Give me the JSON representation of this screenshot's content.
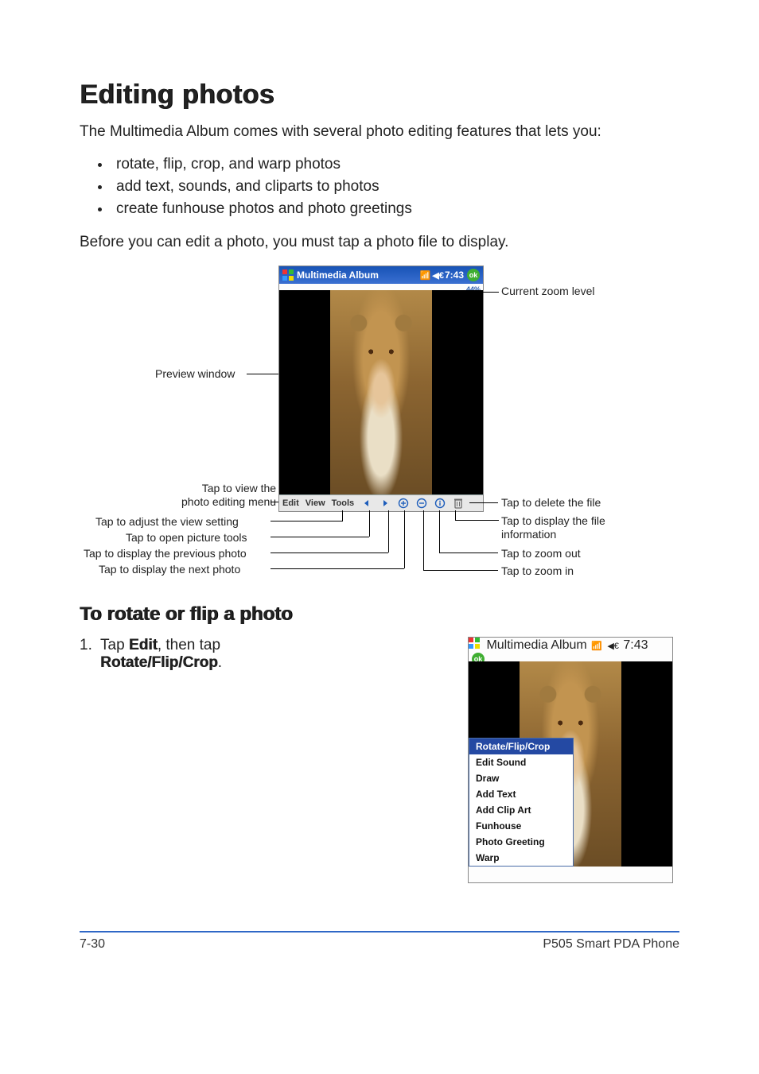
{
  "heading": "Editing photos",
  "intro": "The Multimedia Album comes with several photo editing features that lets you:",
  "features": [
    "rotate, flip, crop, and warp photos",
    "add text, sounds, and cliparts to photos",
    "create funhouse photos and photo greetings"
  ],
  "pre_edit_note": "Before you can edit a photo, you must tap a photo file to display.",
  "pda": {
    "title": "Multimedia Album",
    "time": "7:43",
    "ok": "ok",
    "zoom_level": "44%",
    "toolbar": {
      "edit": "Edit",
      "view": "View",
      "tools": "Tools"
    }
  },
  "callouts": {
    "zoom": "Current zoom level",
    "preview": "Preview window",
    "menu": "Tap to view the\nphoto editing menu",
    "view_setting": "Tap to adjust the view setting",
    "picture_tools": "Tap to open picture tools",
    "prev_photo": "Tap to display the  previous photo",
    "next_photo": "Tap to display the  next photo",
    "delete": "Tap to delete the file",
    "info": "Tap to display the file information",
    "zoom_out": "Tap to zoom out",
    "zoom_in": "Tap to zoom in"
  },
  "sub_heading": "To rotate or flip a photo",
  "step1": {
    "num": "1.",
    "pre": "Tap ",
    "edit": "Edit",
    "mid": ", then tap ",
    "cmd": "Rotate/Flip/Crop",
    "post": "."
  },
  "edit_menu": [
    "Rotate/Flip/Crop",
    "Edit Sound",
    "Draw",
    "Add Text",
    "Add Clip Art",
    "Funhouse",
    "Photo Greeting",
    "Warp"
  ],
  "footer": {
    "left": "7-30",
    "right": "P505 Smart PDA Phone"
  }
}
